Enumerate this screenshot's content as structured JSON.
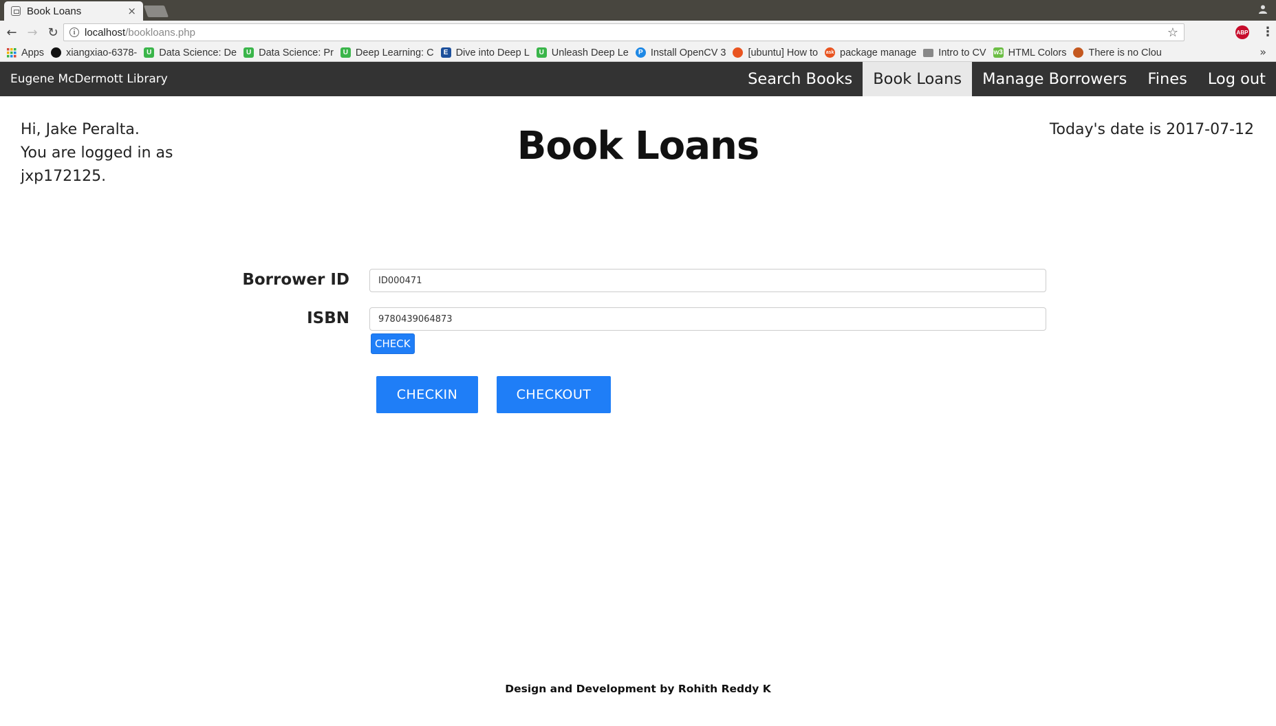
{
  "browser": {
    "tab_title": "Book Loans",
    "tab_close": "×",
    "url_host": "localhost",
    "url_path": "/bookloans.php",
    "abp_label": "ABP",
    "bookmarks": [
      {
        "label": "Apps",
        "icon": "apps-grid-icon",
        "color": "#d64a3c"
      },
      {
        "label": "xiangxiao-6378-",
        "icon": "github-icon",
        "color": "#111111"
      },
      {
        "label": "Data Science: De",
        "icon": "udacity-icon",
        "color": "#3ab54a"
      },
      {
        "label": "Data Science: Pr",
        "icon": "udacity-icon",
        "color": "#3ab54a"
      },
      {
        "label": "Deep Learning: C",
        "icon": "udacity-icon",
        "color": "#3ab54a"
      },
      {
        "label": "Dive into Deep L",
        "icon": "book-icon",
        "color": "#1b4f9b"
      },
      {
        "label": "Unleash Deep Le",
        "icon": "udacity-icon",
        "color": "#3ab54a"
      },
      {
        "label": "Install OpenCV 3",
        "icon": "p-icon",
        "color": "#1e88e5"
      },
      {
        "label": "[ubuntu] How to",
        "icon": "ubuntu-icon",
        "color": "#e95420"
      },
      {
        "label": "package manage",
        "icon": "askubuntu-icon",
        "color": "#e95420"
      },
      {
        "label": "Intro to CV",
        "icon": "folder-icon",
        "color": "#888888"
      },
      {
        "label": "HTML Colors",
        "icon": "w3-icon",
        "color": "#6cbe45"
      },
      {
        "label": "There is no Clou",
        "icon": "fox-icon",
        "color": "#c4581f"
      }
    ]
  },
  "site": {
    "brand": "Eugene McDermott Library",
    "nav": [
      {
        "label": "Search Books",
        "active": false
      },
      {
        "label": "Book Loans",
        "active": true
      },
      {
        "label": "Manage Borrowers",
        "active": false
      },
      {
        "label": "Fines",
        "active": false
      },
      {
        "label": "Log out",
        "active": false
      }
    ]
  },
  "page": {
    "greeting_line1": "Hi, Jake Peralta.",
    "greeting_line2": "You are logged in as",
    "greeting_line3": "jxp172125.",
    "date_text": "Today's date is 2017-07-12",
    "title": "Book Loans",
    "form": {
      "borrower_label": "Borrower ID",
      "borrower_value": "ID000471",
      "isbn_label": "ISBN",
      "isbn_value": "9780439064873",
      "check_label": "CHECK",
      "checkin_label": "CHECKIN",
      "checkout_label": "CHECKOUT"
    },
    "footer": "Design and Development by Rohith Reddy K"
  },
  "colors": {
    "nav_bg": "#333333",
    "nav_active_bg": "#e8e8e8",
    "button_blue": "#1f7ef7"
  }
}
